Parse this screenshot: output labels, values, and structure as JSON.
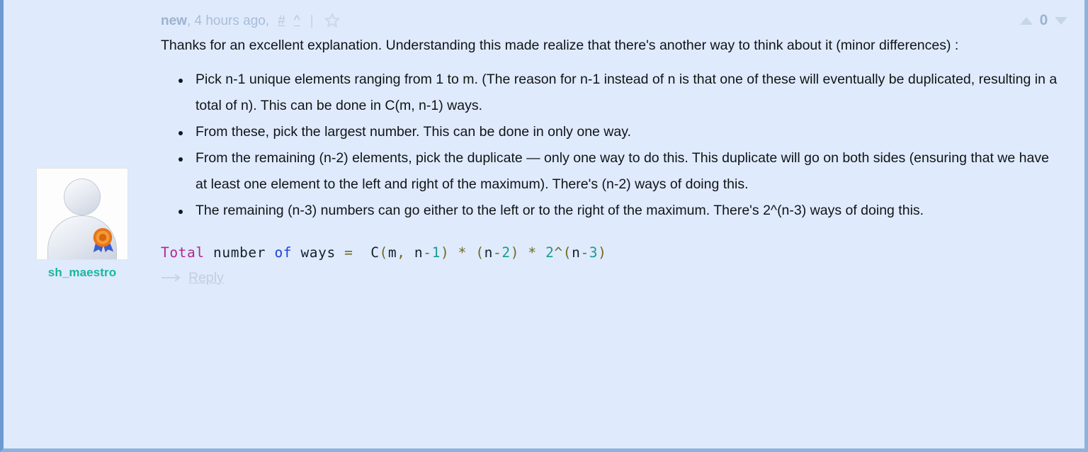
{
  "comment": {
    "header": {
      "new_label": "new",
      "timestamp": ", 4 hours ago,",
      "permalink_label": "#",
      "parent_link_label": "^",
      "separator": "|",
      "favorite_icon": "star-icon",
      "upvote_icon": "triangle-up-icon",
      "downvote_icon": "triangle-down-icon",
      "vote_count": "0"
    },
    "author": {
      "username": "sh_maestro",
      "avatar_icon": "default-user-avatar",
      "badge_icon": "award-ribbon-icon",
      "username_color": "#18b6a0"
    },
    "body": {
      "intro": "Thanks for an excellent explanation. Understanding this made realize that there's another way to think about it (minor differences) :",
      "bullets": [
        "Pick n-1 unique elements ranging from 1 to m. (The reason for n-1 instead of n is that one of these will eventually be duplicated, resulting in a total of n). This can be done in C(m, n-1) ways.",
        "From these, pick the largest number. This can be done in only one way.",
        "From the remaining (n-2) elements, pick the duplicate — only one way to do this. This duplicate will go on both sides (ensuring that we have at least one element to the left and right of the maximum). There's (n-2) ways of doing this.",
        "The remaining (n-3) numbers can go either to the left or to the right of the maximum. There's 2^(n-3) ways of doing this."
      ],
      "code": {
        "full_text": "Total number of ways =  C(m, n-1) * (n-2) * 2^(n-3)",
        "tokens": [
          {
            "text": "Total",
            "style": "kw"
          },
          {
            "text": " number ",
            "style": "txt"
          },
          {
            "text": "of",
            "style": "op"
          },
          {
            "text": " ways ",
            "style": "txt"
          },
          {
            "text": "=",
            "style": "punc"
          },
          {
            "text": "  C",
            "style": "txt"
          },
          {
            "text": "(",
            "style": "punc"
          },
          {
            "text": "m",
            "style": "txt"
          },
          {
            "text": ", ",
            "style": "punc"
          },
          {
            "text": "n",
            "style": "txt"
          },
          {
            "text": "-",
            "style": "punc"
          },
          {
            "text": "1",
            "style": "num"
          },
          {
            "text": ")",
            "style": "punc"
          },
          {
            "text": " ",
            "style": "txt"
          },
          {
            "text": "*",
            "style": "punc"
          },
          {
            "text": " ",
            "style": "txt"
          },
          {
            "text": "(",
            "style": "punc"
          },
          {
            "text": "n",
            "style": "txt"
          },
          {
            "text": "-",
            "style": "punc"
          },
          {
            "text": "2",
            "style": "num"
          },
          {
            "text": ")",
            "style": "punc"
          },
          {
            "text": " ",
            "style": "txt"
          },
          {
            "text": "*",
            "style": "punc"
          },
          {
            "text": " ",
            "style": "txt"
          },
          {
            "text": "2",
            "style": "num"
          },
          {
            "text": "^",
            "style": "punc"
          },
          {
            "text": "(",
            "style": "punc"
          },
          {
            "text": "n",
            "style": "txt"
          },
          {
            "text": "-",
            "style": "punc"
          },
          {
            "text": "3",
            "style": "num"
          },
          {
            "text": ")",
            "style": "punc"
          }
        ]
      }
    },
    "footer": {
      "reply_arrow_icon": "long-arrow-right-icon",
      "reply_label": "Reply"
    }
  },
  "theme": {
    "background": "#dfeafc",
    "border_left": "#6b9ad2",
    "border": "#8fb2dd",
    "text": "#111418",
    "muted": "#a9bdd8"
  }
}
